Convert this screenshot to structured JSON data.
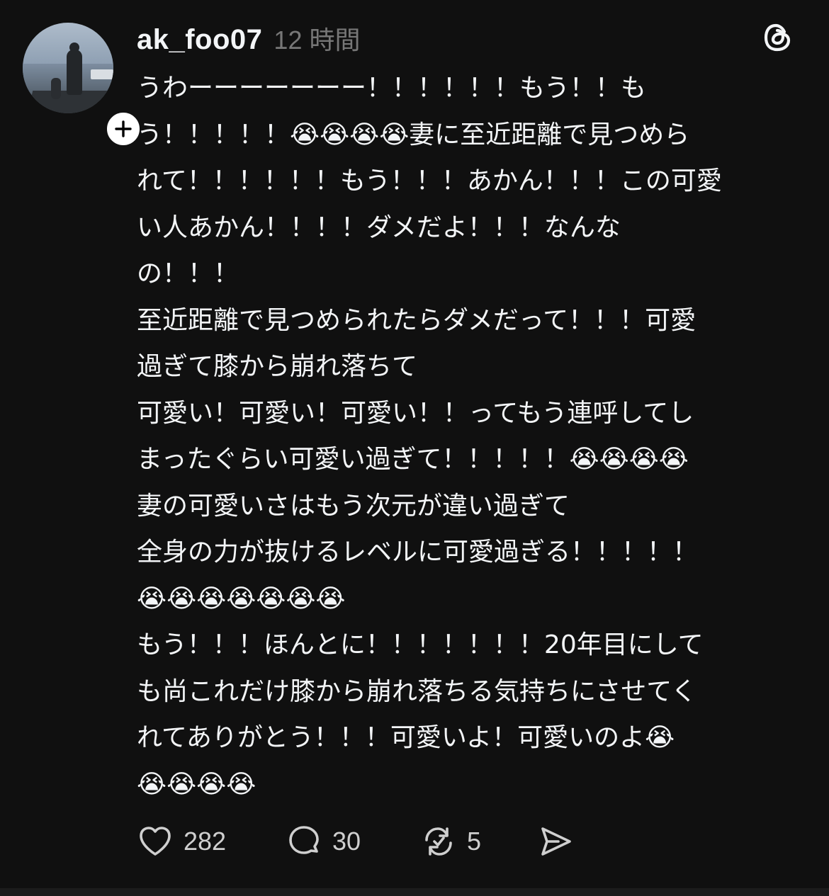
{
  "post": {
    "username": "ak_foo07",
    "timestamp": "12 時間",
    "lines": [
      "うわーーーーーーー！！！！！！もう！！も",
      "う！！！！！😭😭😭😭妻に至近距離で見つめら",
      "れて！！！！！！もう！！！あかん！！！この可愛",
      "い人あかん！！！！ダメだよ！！！なんな",
      "の！！！",
      "至近距離で見つめられたらダメだって！！！可愛",
      "過ぎて膝から崩れ落ちて",
      "可愛い！可愛い！可愛い！！ってもう連呼してし",
      "まったぐらい可愛い過ぎて！！！！！😭😭😭😭",
      "妻の可愛いさはもう次元が違い過ぎて",
      "全身の力が抜けるレベルに可愛過ぎる！！！！！",
      "😭😭😭😭😭😭😭",
      "もう！！！ほんとに！！！！！！！20年目にして",
      "も尚これだけ膝から崩れ落ちる気持ちにさせてく",
      "れてありがとう！！！可愛いよ！可愛いのよ😭",
      "😭😭😭😭"
    ]
  },
  "actions": {
    "likes": "282",
    "replies": "30",
    "reposts": "5"
  },
  "icons": {
    "avatar": "profile-photo",
    "follow": "plus-icon",
    "brand": "threads-logo-icon",
    "like": "heart-icon",
    "reply": "comment-bubble-icon",
    "repost": "repost-icon",
    "share": "send-icon"
  },
  "colors": {
    "background": "#101010",
    "text": "#f3f5f7",
    "muted": "#777777"
  }
}
